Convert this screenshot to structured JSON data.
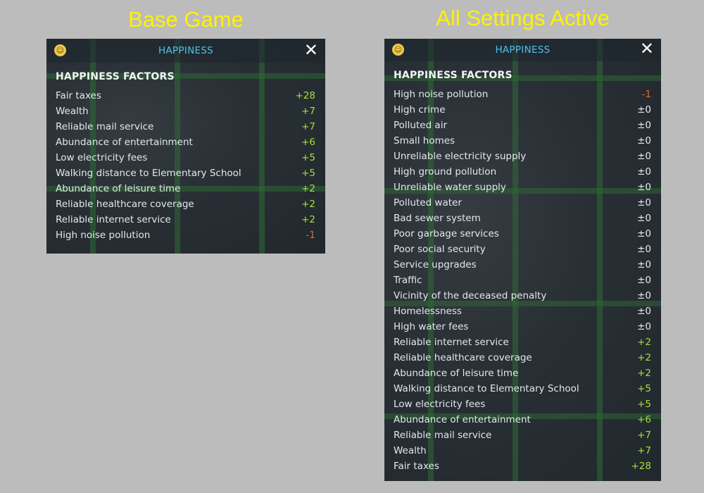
{
  "captions": {
    "left": "Base Game",
    "right": "All Settings Active"
  },
  "panels": {
    "base": {
      "title": "HAPPINESS",
      "section_title": "HAPPINESS FACTORS",
      "close_glyph": "✕",
      "icon": "smiley-face-icon",
      "factors": [
        {
          "label": "Fair taxes",
          "value": "+28",
          "sign": "pos"
        },
        {
          "label": "Wealth",
          "value": "+7",
          "sign": "pos"
        },
        {
          "label": "Reliable mail service",
          "value": "+7",
          "sign": "pos"
        },
        {
          "label": "Abundance of entertainment",
          "value": "+6",
          "sign": "pos"
        },
        {
          "label": "Low electricity fees",
          "value": "+5",
          "sign": "pos"
        },
        {
          "label": "Walking distance to Elementary School",
          "value": "+5",
          "sign": "pos"
        },
        {
          "label": "Abundance of leisure time",
          "value": "+2",
          "sign": "pos"
        },
        {
          "label": "Reliable healthcare coverage",
          "value": "+2",
          "sign": "pos"
        },
        {
          "label": "Reliable internet service",
          "value": "+2",
          "sign": "pos"
        },
        {
          "label": "High noise pollution",
          "value": "-1",
          "sign": "neg"
        }
      ]
    },
    "all": {
      "title": "HAPPINESS",
      "section_title": "HAPPINESS FACTORS",
      "close_glyph": "✕",
      "icon": "smiley-face-icon",
      "factors": [
        {
          "label": "High noise pollution",
          "value": "-1",
          "sign": "neg"
        },
        {
          "label": "High crime",
          "value": "±0",
          "sign": "zero"
        },
        {
          "label": "Polluted air",
          "value": "±0",
          "sign": "zero"
        },
        {
          "label": "Small homes",
          "value": "±0",
          "sign": "zero"
        },
        {
          "label": "Unreliable electricity supply",
          "value": "±0",
          "sign": "zero"
        },
        {
          "label": "High ground pollution",
          "value": "±0",
          "sign": "zero"
        },
        {
          "label": "Unreliable water supply",
          "value": "±0",
          "sign": "zero"
        },
        {
          "label": "Polluted water",
          "value": "±0",
          "sign": "zero"
        },
        {
          "label": "Bad sewer system",
          "value": "±0",
          "sign": "zero"
        },
        {
          "label": "Poor garbage services",
          "value": "±0",
          "sign": "zero"
        },
        {
          "label": "Poor social security",
          "value": "±0",
          "sign": "zero"
        },
        {
          "label": "Service upgrades",
          "value": "±0",
          "sign": "zero"
        },
        {
          "label": "Traffic",
          "value": "±0",
          "sign": "zero"
        },
        {
          "label": "Vicinity of the deceased penalty",
          "value": "±0",
          "sign": "zero"
        },
        {
          "label": "Homelessness",
          "value": "±0",
          "sign": "zero"
        },
        {
          "label": "High water fees",
          "value": "±0",
          "sign": "zero"
        },
        {
          "label": "Reliable internet service",
          "value": "+2",
          "sign": "pos"
        },
        {
          "label": "Reliable healthcare coverage",
          "value": "+2",
          "sign": "pos"
        },
        {
          "label": "Abundance of leisure time",
          "value": "+2",
          "sign": "pos"
        },
        {
          "label": "Walking distance to Elementary School",
          "value": "+5",
          "sign": "pos"
        },
        {
          "label": "Low electricity fees",
          "value": "+5",
          "sign": "pos"
        },
        {
          "label": "Abundance of entertainment",
          "value": "+6",
          "sign": "pos"
        },
        {
          "label": "Reliable mail service",
          "value": "+7",
          "sign": "pos"
        },
        {
          "label": "Wealth",
          "value": "+7",
          "sign": "pos"
        },
        {
          "label": "Fair taxes",
          "value": "+28",
          "sign": "pos"
        }
      ]
    }
  },
  "colors": {
    "title": "#4fc3ee",
    "positive": "#a6e03a",
    "negative": "#e8643a",
    "neutral": "#e8ecf0",
    "caption": "#fff200"
  }
}
